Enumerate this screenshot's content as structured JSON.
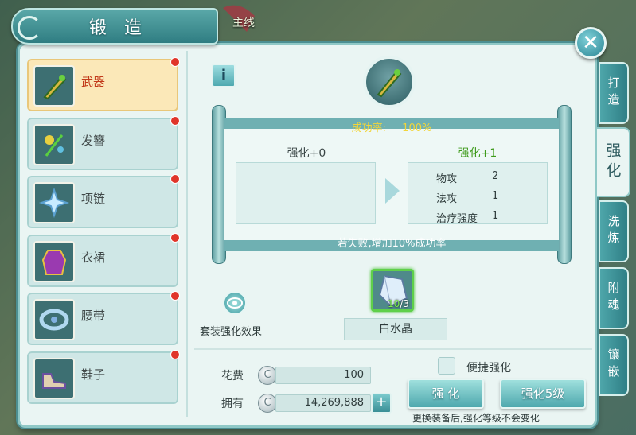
{
  "quest_tag": "主线",
  "title": "锻造",
  "left_slots": [
    {
      "label": "武器",
      "active": true,
      "icon": "weapon-icon"
    },
    {
      "label": "发簪",
      "active": false,
      "icon": "hairpin-icon"
    },
    {
      "label": "项链",
      "active": false,
      "icon": "necklace-icon"
    },
    {
      "label": "衣裙",
      "active": false,
      "icon": "dress-icon"
    },
    {
      "label": "腰带",
      "active": false,
      "icon": "belt-icon"
    },
    {
      "label": "鞋子",
      "active": false,
      "icon": "shoes-icon"
    }
  ],
  "scroll": {
    "rate_label": "成功率:",
    "rate_value": "100%",
    "current_level": "强化+0",
    "next_level": "强化+1",
    "stats": [
      {
        "name": "物攻",
        "value": "2"
      },
      {
        "name": "法攻",
        "value": "1"
      },
      {
        "name": "治疗强度",
        "value": "1"
      }
    ],
    "fail_text": "若失败,增加10%成功率"
  },
  "material": {
    "have": "10",
    "need": "/3",
    "name": "白水晶"
  },
  "set_effect_label": "套装强化效果",
  "cost": {
    "cost_label": "花费",
    "cost_value": "100",
    "own_label": "拥有",
    "own_value": "14,269,888",
    "coin_glyph": "C"
  },
  "quick_enhance_label": "便捷强化",
  "buttons": {
    "enhance": "强 化",
    "enhance5": "强化5级"
  },
  "note": "更换装备后,强化等级不会变化",
  "side_tabs": [
    {
      "label": "打造",
      "active": false
    },
    {
      "label": "强化",
      "active": true
    },
    {
      "label": "洗炼",
      "active": false
    },
    {
      "label": "附魂",
      "active": false
    },
    {
      "label": "镶嵌",
      "active": false
    }
  ],
  "colors": {
    "accent": "#4ea8ae",
    "success_green": "#3d9a1a",
    "badge_red": "#e0352a",
    "rate_yellow": "#f2d53a"
  }
}
